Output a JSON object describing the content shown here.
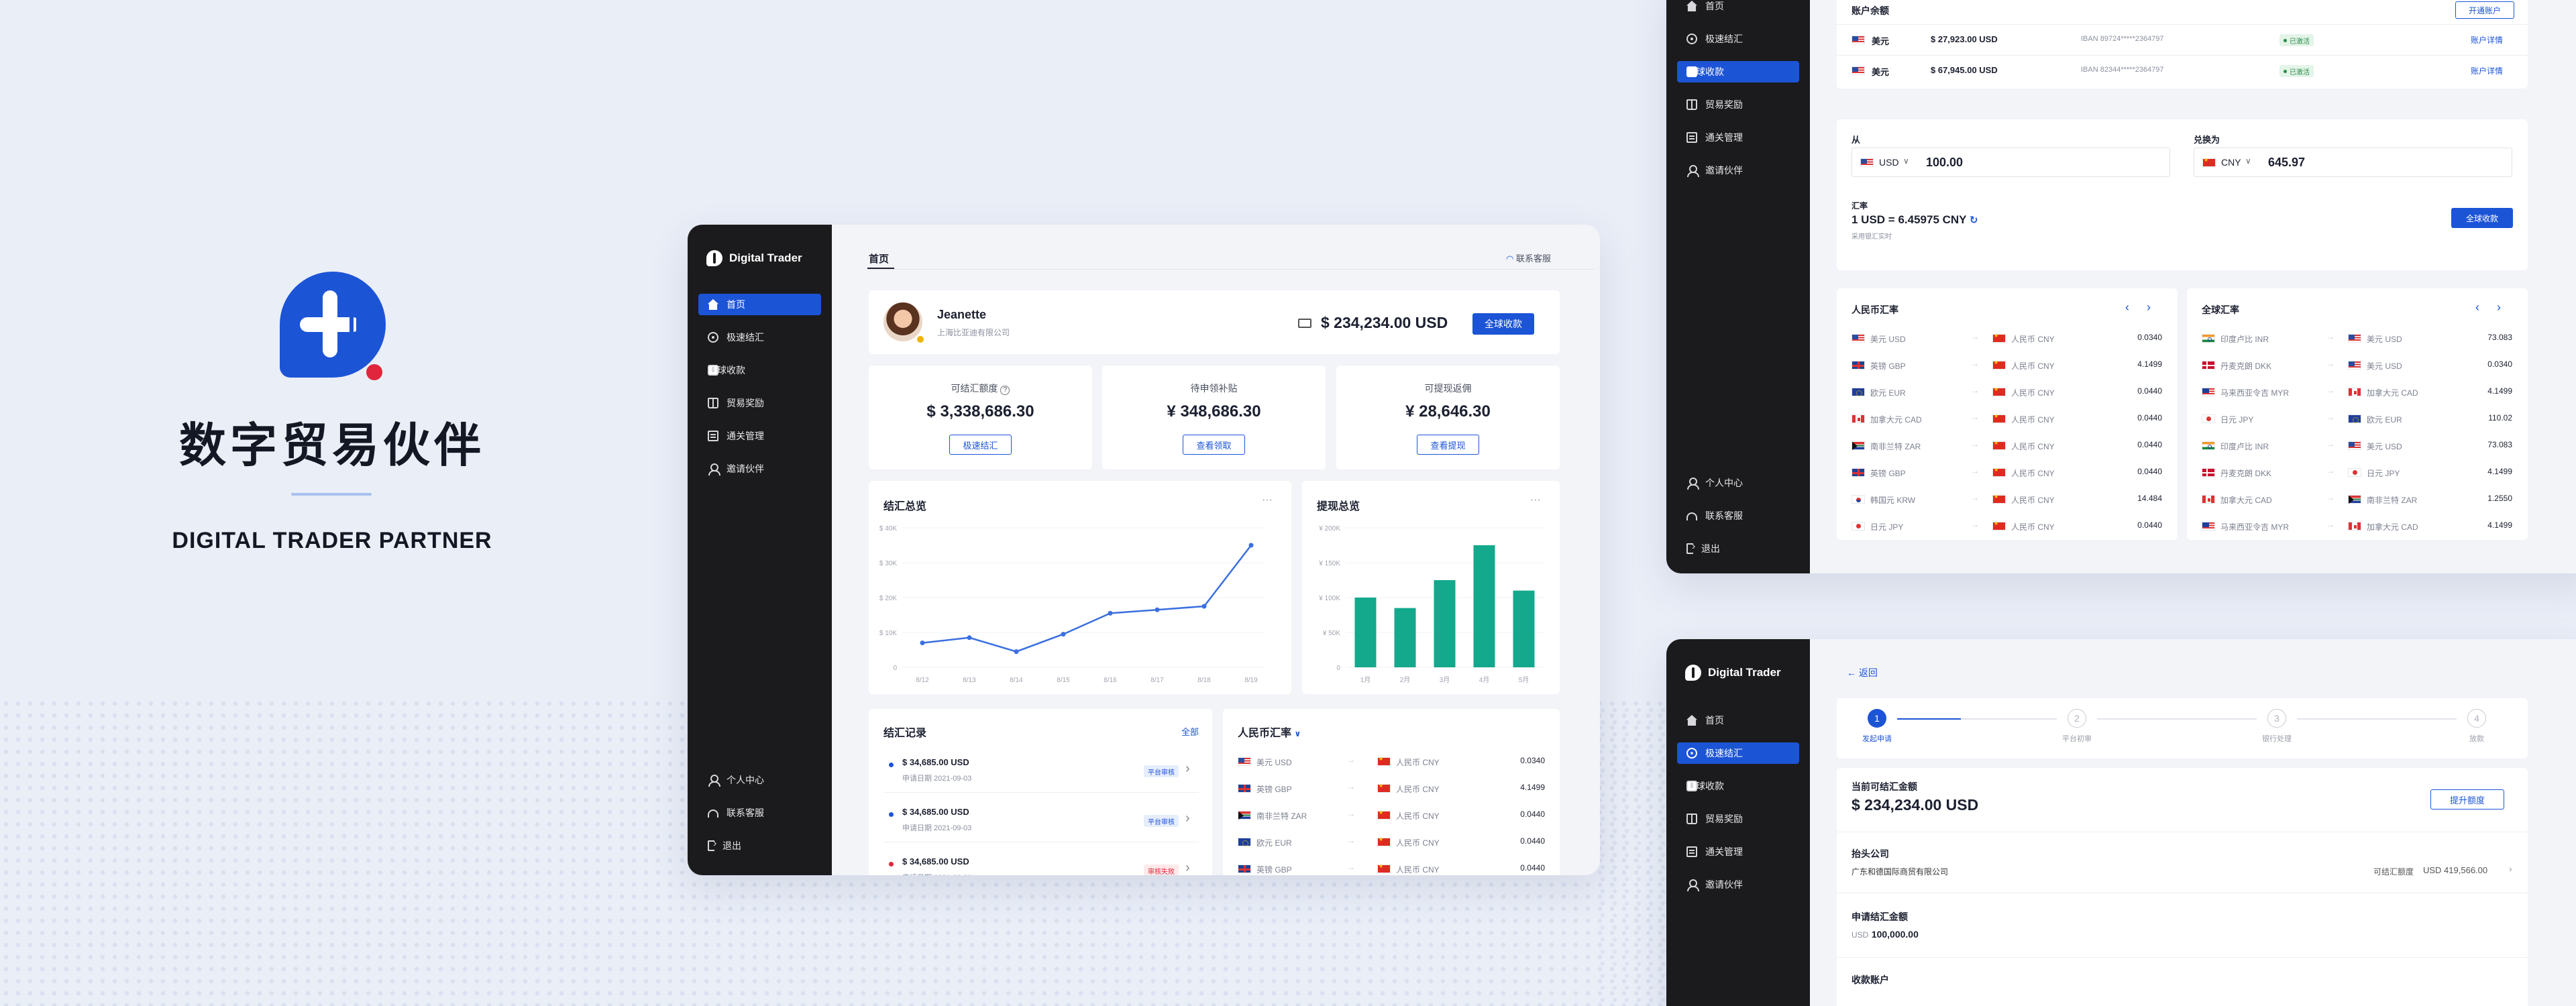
{
  "brand": {
    "title_cn": "数字贸易伙伴",
    "title_en": "DIGITAL TRADER PARTNER"
  },
  "app": {
    "name": "Digital Trader"
  },
  "nav": {
    "home": "首页",
    "quick_settle": "极速结汇",
    "global_collect": "全球收款",
    "trade_reward": "贸易奖励",
    "customs": "通关管理",
    "invite": "邀请伙伴",
    "profile": "个人中心",
    "support": "联系客服",
    "logout": "退出"
  },
  "colors": {
    "accent": "#1c54d6",
    "sidebar": "#1b1b1d",
    "bar": "#14a98d",
    "background": "#eaeef7"
  },
  "dashboard": {
    "tab": "首页",
    "contact": "联系客服",
    "user": {
      "name": "Jeanette",
      "company": "上海比亚迪有限公司"
    },
    "balance": "$ 234,234.00 USD",
    "collect_btn": "全球收款",
    "stats": [
      {
        "label": "可结汇额度",
        "value": "$ 3,338,686.30",
        "btn": "极速结汇"
      },
      {
        "label": "待申领补贴",
        "value": "¥ 348,686.30",
        "btn": "查看领取"
      },
      {
        "label": "可提现返佣",
        "value": "¥ 28,646.30",
        "btn": "查看提现"
      }
    ],
    "settle_chart": {
      "title": "结汇总览",
      "more": "···"
    },
    "withdraw_chart": {
      "title": "提现总览",
      "more": "···"
    },
    "records": {
      "title": "结汇记录",
      "all": "全部",
      "items": [
        {
          "amount": "$ 34,685.00 USD",
          "date": "申请日期  2021-09-03",
          "status": "平台审核",
          "dot": "#1c54d6",
          "tag_bg": "#e6edfb",
          "tag_fg": "#1c54d6"
        },
        {
          "amount": "$ 34,685.00 USD",
          "date": "申请日期  2021-09-03",
          "status": "平台审核",
          "dot": "#1c54d6",
          "tag_bg": "#e6edfb",
          "tag_fg": "#1c54d6"
        },
        {
          "amount": "$ 34,685.00 USD",
          "date": "申请日期  2021-09-03",
          "status": "审核失败",
          "dot": "#e0263c",
          "tag_bg": "#fdeaea",
          "tag_fg": "#e0263c"
        }
      ]
    },
    "rates": {
      "title": "人民币汇率",
      "rows": [
        {
          "f1": "us",
          "c1": "美元 USD",
          "f2": "cn",
          "c2": "人民币 CNY",
          "rate": "0.0340"
        },
        {
          "f1": "gb",
          "c1": "英镑 GBP",
          "f2": "cn",
          "c2": "人民币 CNY",
          "rate": "4.1499"
        },
        {
          "f1": "za",
          "c1": "南非兰特 ZAR",
          "f2": "cn",
          "c2": "人民币 CNY",
          "rate": "0.0440"
        },
        {
          "f1": "eu",
          "c1": "欧元 EUR",
          "f2": "cn",
          "c2": "人民币 CNY",
          "rate": "0.0440"
        },
        {
          "f1": "gb",
          "c1": "英镑 GBP",
          "f2": "cn",
          "c2": "人民币 CNY",
          "rate": "0.0440"
        }
      ]
    }
  },
  "chart_data": [
    {
      "type": "line",
      "title": "结汇总览",
      "categories": [
        "8/12",
        "8/13",
        "8/14",
        "8/15",
        "8/16",
        "8/17",
        "8/18",
        "8/19"
      ],
      "values": [
        7000,
        8500,
        4500,
        9500,
        15500,
        16500,
        17500,
        35000
      ],
      "ylim": [
        0,
        40000
      ],
      "yticks": [
        "0",
        "$ 10K",
        "$ 20K",
        "$ 30K",
        "$ 40K"
      ]
    },
    {
      "type": "bar",
      "title": "提现总览",
      "categories": [
        "1月",
        "2月",
        "3月",
        "4月",
        "5月"
      ],
      "values": [
        100000,
        85000,
        125000,
        175000,
        110000
      ],
      "ylim": [
        0,
        200000
      ],
      "yticks": [
        "0",
        "¥ 50K",
        "¥ 100K",
        "¥ 150K",
        "¥ 200K"
      ]
    }
  ],
  "global": {
    "balance_title": "账户余额",
    "open_btn": "开通账户",
    "accounts": [
      {
        "cur": "美元",
        "amount": "$ 27,923.00 USD",
        "iban": "IBAN 89724*****2364797",
        "status": "已激活",
        "link": "账户详情"
      },
      {
        "cur": "美元",
        "amount": "$ 67,945.00 USD",
        "iban": "IBAN 82344*****2364797",
        "status": "已激活",
        "link": "账户详情"
      }
    ],
    "from_label": "从",
    "from_cur": "USD",
    "from_val": "100.00",
    "to_label": "兑换为",
    "to_cur": "CNY",
    "to_val": "645.97",
    "rate_label": "汇率",
    "rate_val": "1 USD = 6.45975 CNY",
    "rate_note": "采用银汇实时",
    "collect_btn": "全球收款",
    "cny_title": "人民币汇率",
    "cny_rows": [
      {
        "f1": "us",
        "c1": "美元 USD",
        "f2": "cn",
        "c2": "人民币 CNY",
        "rate": "0.0340"
      },
      {
        "f1": "gb",
        "c1": "英镑 GBP",
        "f2": "cn",
        "c2": "人民币 CNY",
        "rate": "4.1499"
      },
      {
        "f1": "eu",
        "c1": "欧元 EUR",
        "f2": "cn",
        "c2": "人民币 CNY",
        "rate": "0.0440"
      },
      {
        "f1": "ca",
        "c1": "加拿大元 CAD",
        "f2": "cn",
        "c2": "人民币 CNY",
        "rate": "0.0440"
      },
      {
        "f1": "za",
        "c1": "南非兰特 ZAR",
        "f2": "cn",
        "c2": "人民币 CNY",
        "rate": "0.0440"
      },
      {
        "f1": "gb",
        "c1": "英镑 GBP",
        "f2": "cn",
        "c2": "人民币 CNY",
        "rate": "0.0440"
      },
      {
        "f1": "kr",
        "c1": "韩国元 KRW",
        "f2": "cn",
        "c2": "人民币 CNY",
        "rate": "14.484"
      },
      {
        "f1": "jp",
        "c1": "日元 JPY",
        "f2": "cn",
        "c2": "人民币 CNY",
        "rate": "0.0440"
      }
    ],
    "world_title": "全球汇率",
    "world_rows": [
      {
        "f1": "in",
        "c1": "印度卢比 INR",
        "f2": "us",
        "c2": "美元 USD",
        "rate": "73.083"
      },
      {
        "f1": "dk",
        "c1": "丹麦克朗 DKK",
        "f2": "us",
        "c2": "美元 USD",
        "rate": "0.0340"
      },
      {
        "f1": "my",
        "c1": "马来西亚令吉 MYR",
        "f2": "ca",
        "c2": "加拿大元 CAD",
        "rate": "4.1499"
      },
      {
        "f1": "jp",
        "c1": "日元 JPY",
        "f2": "eu",
        "c2": "欧元 EUR",
        "rate": "110.02"
      },
      {
        "f1": "in",
        "c1": "印度卢比 INR",
        "f2": "us",
        "c2": "美元 USD",
        "rate": "73.083"
      },
      {
        "f1": "dk",
        "c1": "丹麦克朗 DKK",
        "f2": "jp",
        "c2": "日元 JPY",
        "rate": "4.1499"
      },
      {
        "f1": "ca",
        "c1": "加拿大元 CAD",
        "f2": "za",
        "c2": "南非兰特 ZAR",
        "rate": "1.2550"
      },
      {
        "f1": "my",
        "c1": "马来西亚令吉 MYR",
        "f2": "ca",
        "c2": "加拿大元 CAD",
        "rate": "4.1499"
      }
    ]
  },
  "settle": {
    "back": "返回",
    "steps": [
      {
        "n": "1",
        "label": "发起申请"
      },
      {
        "n": "2",
        "label": "平台初审"
      },
      {
        "n": "3",
        "label": "银行处理"
      },
      {
        "n": "4",
        "label": "放款"
      }
    ],
    "avail_label": "当前可结汇金额",
    "avail_value": "$ 234,234.00 USD",
    "raise_btn": "提升额度",
    "company_label": "抬头公司",
    "company_value": "广东和德国际商贸有限公司",
    "quota_label": "可结汇额度",
    "quota_value": "USD  419,566.00",
    "amount_label": "申请结汇金额",
    "amount_cur": "USD",
    "amount_value": "100,000.00",
    "account_label": "收款账户"
  }
}
